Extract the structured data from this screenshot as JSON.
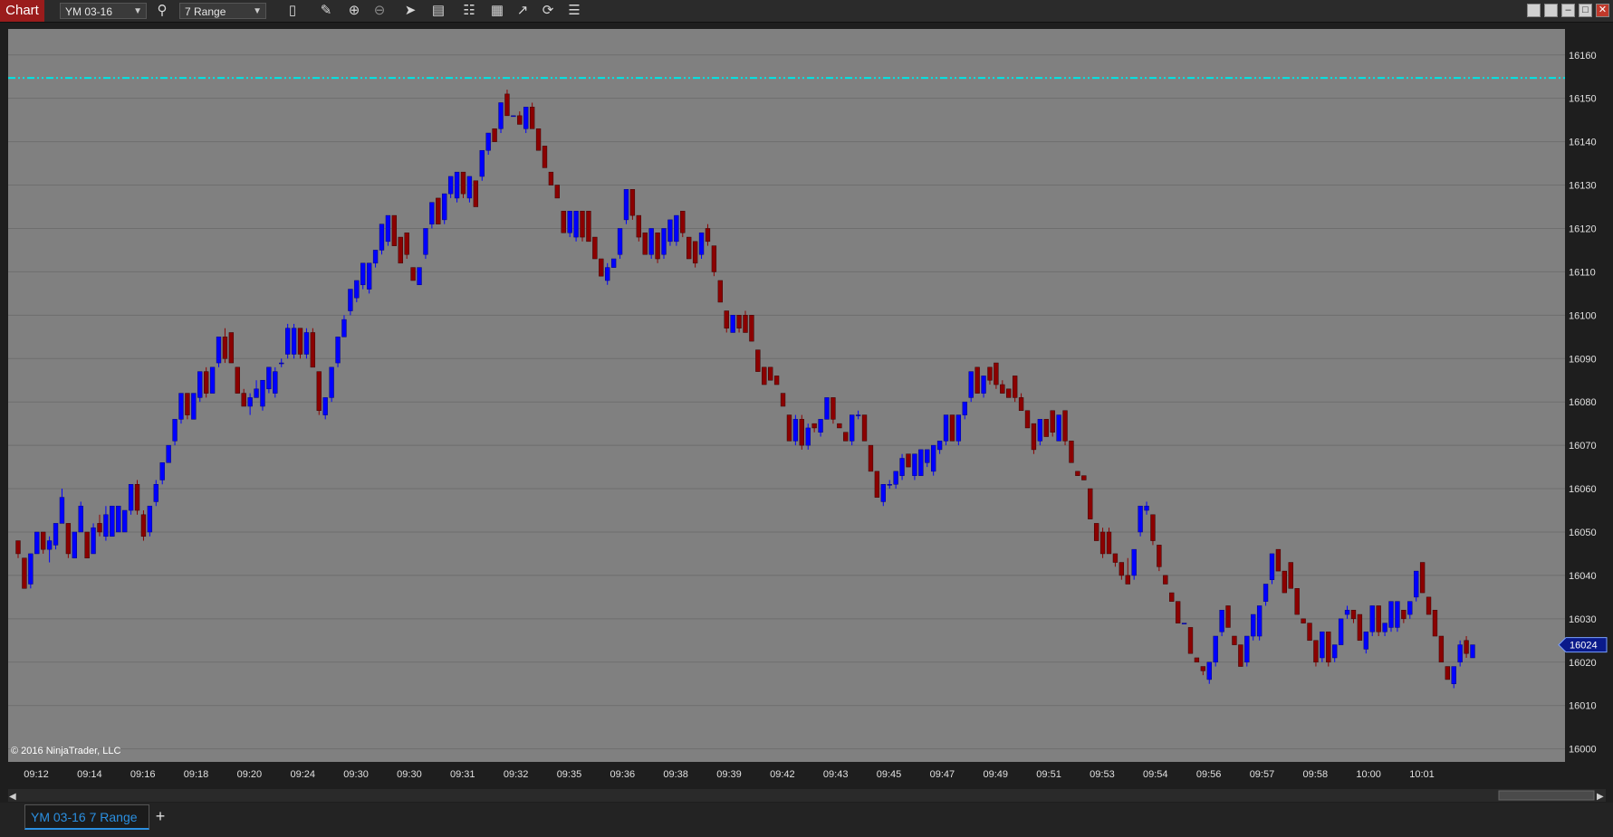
{
  "toolbar": {
    "badge": "Chart",
    "instrument": "YM 03-16",
    "bar_type": "7 Range",
    "icons": [
      "search-icon",
      "bars-style-icon",
      "pencil-icon",
      "zoom-in-icon",
      "zoom-out-icon",
      "pointer-icon",
      "data-box-icon",
      "indicators-icon",
      "strategies-icon",
      "drawing-tools-icon",
      "reload-icon",
      "properties-icon"
    ],
    "window_buttons": [
      "tile-icon",
      "restore-icon",
      "minimize-icon",
      "maximize-icon",
      "close-icon"
    ]
  },
  "colors": {
    "plot_bg": "#808080",
    "up_bar": "#0000ff",
    "down_bar": "#8b0000",
    "level_line": "#00e5e5",
    "last_price_badge": "#0a1a8a",
    "accent": "#2b8fe0",
    "badge_bg": "#9a1c1c"
  },
  "tabs": {
    "active": "YM 03-16 7 Range",
    "add": "+"
  },
  "chart_data": {
    "type": "candlestick",
    "instrument": "YM 03-16",
    "bar_type": "7 Range",
    "copyright": "© 2016 NinjaTrader, LLC",
    "y_ticks": [
      16160,
      16150,
      16140,
      16130,
      16120,
      16110,
      16100,
      16090,
      16080,
      16070,
      16060,
      16050,
      16040,
      16030,
      16020,
      16010,
      16000
    ],
    "ylim": [
      15997,
      16166
    ],
    "x_ticks": [
      "09:12",
      "09:14",
      "09:16",
      "09:18",
      "09:20",
      "09:24",
      "09:30",
      "09:30",
      "09:31",
      "09:32",
      "09:35",
      "09:36",
      "09:38",
      "09:39",
      "09:42",
      "09:43",
      "09:45",
      "09:47",
      "09:49",
      "09:51",
      "09:53",
      "09:54",
      "09:56",
      "09:57",
      "09:58",
      "10:00",
      "10:01"
    ],
    "level_line": 16154.7,
    "last_price": 16024,
    "grid": true,
    "candles": [
      [
        16048,
        16045,
        16048,
        16044
      ],
      [
        16044,
        16037,
        16044,
        16037
      ],
      [
        16038,
        16045,
        16045,
        16037
      ],
      [
        16045,
        16050,
        16050,
        16045
      ],
      [
        16050,
        16046,
        16050,
        16045
      ],
      [
        16046,
        16048,
        16049,
        16043
      ],
      [
        16047,
        16052,
        16052,
        16046
      ],
      [
        16052,
        16058,
        16060,
        16052
      ],
      [
        16052,
        16045,
        16052,
        16044
      ],
      [
        16044,
        16050,
        16050,
        16044
      ],
      [
        16050,
        16056,
        16057,
        16050
      ],
      [
        16050,
        16044,
        16050,
        16044
      ],
      [
        16045,
        16051,
        16052,
        16045
      ],
      [
        16052,
        16050,
        16054,
        16049
      ],
      [
        16049,
        16054,
        16056,
        16048
      ],
      [
        16049,
        16056,
        16056,
        16049
      ],
      [
        16050,
        16056,
        16056,
        16050
      ],
      [
        16050,
        16055,
        16055,
        16050
      ],
      [
        16055,
        16061,
        16061,
        16054
      ],
      [
        16061,
        16055,
        16062,
        16054
      ],
      [
        16054,
        16049,
        16055,
        16048
      ],
      [
        16050,
        16056,
        16056,
        16049
      ],
      [
        16057,
        16061,
        16062,
        16056
      ],
      [
        16062,
        16066,
        16066,
        16061
      ],
      [
        16066,
        16070,
        16070,
        16066
      ],
      [
        16071,
        16076,
        16076,
        16070
      ],
      [
        16076,
        16082,
        16082,
        16075
      ],
      [
        16082,
        16077,
        16082,
        16076
      ],
      [
        16076,
        16082,
        16082,
        16076
      ],
      [
        16081,
        16087,
        16087,
        16080
      ],
      [
        16087,
        16082,
        16088,
        16081
      ],
      [
        16082,
        16088,
        16088,
        16082
      ],
      [
        16089,
        16095,
        16095,
        16088
      ],
      [
        16095,
        16090,
        16097,
        16089
      ],
      [
        16096,
        16089,
        16096,
        16089
      ],
      [
        16088,
        16082,
        16088,
        16082
      ],
      [
        16082,
        16079,
        16083,
        16079
      ],
      [
        16079,
        16081,
        16082,
        16077
      ],
      [
        16081,
        16083,
        16085,
        16081
      ],
      [
        16079,
        16085,
        16085,
        16078
      ],
      [
        16083,
        16088,
        16088,
        16082
      ],
      [
        16082,
        16087,
        16088,
        16081
      ],
      [
        16089,
        16089,
        16090,
        16088
      ],
      [
        16091,
        16097,
        16098,
        16090
      ],
      [
        16091,
        16097,
        16098,
        16090
      ],
      [
        16097,
        16091,
        16097,
        16090
      ],
      [
        16091,
        16096,
        16097,
        16090
      ],
      [
        16096,
        16088,
        16097,
        16088
      ],
      [
        16087,
        16078,
        16087,
        16077
      ],
      [
        16077,
        16081,
        16081,
        16076
      ],
      [
        16081,
        16088,
        16088,
        16080
      ],
      [
        16089,
        16095,
        16095,
        16088
      ],
      [
        16095,
        16099,
        16100,
        16095
      ],
      [
        16101,
        16106,
        16106,
        16100
      ],
      [
        16104,
        16108,
        16108,
        16103
      ],
      [
        16107,
        16112,
        16112,
        16106
      ],
      [
        16106,
        16112,
        16112,
        16105
      ],
      [
        16112,
        16115,
        16115,
        16111
      ],
      [
        16115,
        16121,
        16121,
        16114
      ],
      [
        16117,
        16123,
        16123,
        16116
      ],
      [
        16123,
        16116,
        16123,
        16116
      ],
      [
        16118,
        16112,
        16118,
        16112
      ],
      [
        16119,
        16114,
        16119,
        16113
      ],
      [
        16111,
        16108,
        16111,
        16108
      ],
      [
        16107,
        16111,
        16111,
        16107
      ],
      [
        16114,
        16120,
        16120,
        16113
      ],
      [
        16121,
        16126,
        16126,
        16120
      ],
      [
        16127,
        16121,
        16127,
        16121
      ],
      [
        16122,
        16128,
        16128,
        16121
      ],
      [
        16128,
        16132,
        16132,
        16127
      ],
      [
        16127,
        16133,
        16133,
        16126
      ],
      [
        16133,
        16128,
        16133,
        16127
      ],
      [
        16127,
        16132,
        16132,
        16126
      ],
      [
        16131,
        16125,
        16131,
        16125
      ],
      [
        16132,
        16138,
        16138,
        16131
      ],
      [
        16138,
        16142,
        16142,
        16137
      ],
      [
        16143,
        16140,
        16143,
        16140
      ],
      [
        16143,
        16149,
        16149,
        16142
      ],
      [
        16151,
        16146,
        16152,
        16146
      ],
      [
        16146,
        16146,
        16146,
        16146
      ],
      [
        16146,
        16144,
        16147,
        16144
      ],
      [
        16143,
        16148,
        16148,
        16142
      ],
      [
        16148,
        16143,
        16149,
        16143
      ],
      [
        16143,
        16138,
        16143,
        16138
      ],
      [
        16139,
        16134,
        16139,
        16134
      ],
      [
        16133,
        16130,
        16133,
        16130
      ],
      [
        16130,
        16127,
        16130,
        16127
      ],
      [
        16124,
        16119,
        16124,
        16119
      ],
      [
        16119,
        16124,
        16124,
        16118
      ],
      [
        16118,
        16124,
        16124,
        16117
      ],
      [
        16124,
        16118,
        16124,
        16117
      ],
      [
        16124,
        16117,
        16124,
        16117
      ],
      [
        16118,
        16113,
        16118,
        16113
      ],
      [
        16113,
        16109,
        16113,
        16109
      ],
      [
        16108,
        16111,
        16112,
        16107
      ],
      [
        16111,
        16113,
        16113,
        16111
      ],
      [
        16114,
        16120,
        16120,
        16113
      ],
      [
        16122,
        16129,
        16129,
        16121
      ],
      [
        16129,
        16123,
        16129,
        16122
      ],
      [
        16123,
        16118,
        16123,
        16117
      ],
      [
        16119,
        16114,
        16119,
        16114
      ],
      [
        16114,
        16120,
        16120,
        16113
      ],
      [
        16119,
        16113,
        16119,
        16112
      ],
      [
        16114,
        16120,
        16120,
        16113
      ],
      [
        16117,
        16122,
        16122,
        16116
      ],
      [
        16117,
        16123,
        16123,
        16116
      ],
      [
        16124,
        16119,
        16124,
        16118
      ],
      [
        16118,
        16113,
        16118,
        16113
      ],
      [
        16117,
        16112,
        16117,
        16111
      ],
      [
        16114,
        16119,
        16119,
        16113
      ],
      [
        16120,
        16117,
        16121,
        16116
      ],
      [
        16116,
        16110,
        16116,
        16109
      ],
      [
        16108,
        16103,
        16108,
        16103
      ],
      [
        16101,
        16097,
        16101,
        16096
      ],
      [
        16096,
        16100,
        16100,
        16096
      ],
      [
        16100,
        16097,
        16100,
        16096
      ],
      [
        16100,
        16096,
        16101,
        16096
      ],
      [
        16100,
        16094,
        16100,
        16094
      ],
      [
        16092,
        16087,
        16092,
        16087
      ],
      [
        16088,
        16084,
        16088,
        16084
      ],
      [
        16088,
        16085,
        16088,
        16085
      ],
      [
        16086,
        16084,
        16086,
        16084
      ],
      [
        16082,
        16079,
        16082,
        16079
      ],
      [
        16077,
        16071,
        16077,
        16071
      ],
      [
        16071,
        16076,
        16077,
        16070
      ],
      [
        16076,
        16070,
        16077,
        16069
      ],
      [
        16070,
        16074,
        16075,
        16069
      ],
      [
        16075,
        16074,
        16075,
        16073
      ],
      [
        16073,
        16076,
        16076,
        16072
      ],
      [
        16076,
        16081,
        16081,
        16076
      ],
      [
        16081,
        16076,
        16081,
        16075
      ],
      [
        16075,
        16074,
        16075,
        16074
      ],
      [
        16073,
        16071,
        16073,
        16071
      ],
      [
        16071,
        16077,
        16077,
        16070
      ],
      [
        16077,
        16077,
        16078,
        16076
      ],
      [
        16077,
        16071,
        16077,
        16071
      ],
      [
        16070,
        16064,
        16070,
        16064
      ],
      [
        16064,
        16058,
        16064,
        16058
      ],
      [
        16057,
        16061,
        16061,
        16056
      ],
      [
        16061,
        16061,
        16062,
        16060
      ],
      [
        16061,
        16064,
        16064,
        16060
      ],
      [
        16063,
        16067,
        16068,
        16062
      ],
      [
        16068,
        16065,
        16068,
        16065
      ],
      [
        16063,
        16068,
        16068,
        16062
      ],
      [
        16063,
        16069,
        16069,
        16063
      ],
      [
        16066,
        16069,
        16069,
        16065
      ],
      [
        16064,
        16070,
        16070,
        16063
      ],
      [
        16069,
        16071,
        16071,
        16068
      ],
      [
        16071,
        16077,
        16077,
        16070
      ],
      [
        16077,
        16071,
        16077,
        16071
      ],
      [
        16071,
        16077,
        16077,
        16070
      ],
      [
        16077,
        16080,
        16080,
        16076
      ],
      [
        16081,
        16087,
        16087,
        16080
      ],
      [
        16088,
        16082,
        16088,
        16082
      ],
      [
        16082,
        16086,
        16086,
        16081
      ],
      [
        16088,
        16085,
        16088,
        16084
      ],
      [
        16089,
        16084,
        16089,
        16083
      ],
      [
        16084,
        16082,
        16085,
        16082
      ],
      [
        16083,
        16081,
        16083,
        16081
      ],
      [
        16086,
        16081,
        16086,
        16080
      ],
      [
        16081,
        16078,
        16082,
        16078
      ],
      [
        16078,
        16074,
        16078,
        16074
      ],
      [
        16075,
        16069,
        16075,
        16068
      ],
      [
        16071,
        16076,
        16076,
        16070
      ],
      [
        16076,
        16072,
        16076,
        16072
      ],
      [
        16078,
        16073,
        16078,
        16072
      ],
      [
        16071,
        16077,
        16077,
        16071
      ],
      [
        16078,
        16071,
        16078,
        16070
      ],
      [
        16071,
        16066,
        16071,
        16066
      ],
      [
        16064,
        16063,
        16064,
        16063
      ],
      [
        16063,
        16062,
        16063,
        16062
      ],
      [
        16060,
        16053,
        16060,
        16053
      ],
      [
        16052,
        16048,
        16052,
        16048
      ],
      [
        16050,
        16045,
        16051,
        16044
      ],
      [
        16050,
        16045,
        16051,
        16045
      ],
      [
        16045,
        16043,
        16045,
        16042
      ],
      [
        16043,
        16040,
        16043,
        16039
      ],
      [
        16040,
        16038,
        16044,
        16038
      ],
      [
        16040,
        16046,
        16046,
        16039
      ],
      [
        16050,
        16056,
        16056,
        16049
      ],
      [
        16055,
        16056,
        16057,
        16054
      ],
      [
        16054,
        16048,
        16054,
        16047
      ],
      [
        16047,
        16042,
        16047,
        16041
      ],
      [
        16040,
        16038,
        16040,
        16038
      ],
      [
        16036,
        16034,
        16036,
        16034
      ],
      [
        16034,
        16029,
        16034,
        16029
      ],
      [
        16029,
        16029,
        16029,
        16029
      ],
      [
        16028,
        16022,
        16028,
        16022
      ],
      [
        16021,
        16020,
        16021,
        16020
      ],
      [
        16019,
        16018,
        16019,
        16017
      ],
      [
        16016,
        16020,
        16020,
        16015
      ],
      [
        16020,
        16026,
        16026,
        16019
      ],
      [
        16027,
        16032,
        16032,
        16026
      ],
      [
        16033,
        16028,
        16033,
        16028
      ],
      [
        16026,
        16024,
        16026,
        16024
      ],
      [
        16024,
        16019,
        16024,
        16019
      ],
      [
        16020,
        16026,
        16026,
        16019
      ],
      [
        16026,
        16031,
        16031,
        16025
      ],
      [
        16026,
        16033,
        16033,
        16025
      ],
      [
        16034,
        16038,
        16038,
        16033
      ],
      [
        16039,
        16045,
        16045,
        16038
      ],
      [
        16046,
        16041,
        16046,
        16041
      ],
      [
        16041,
        16036,
        16041,
        16036
      ],
      [
        16043,
        16037,
        16043,
        16037
      ],
      [
        16037,
        16031,
        16037,
        16031
      ],
      [
        16030,
        16029,
        16030,
        16029
      ],
      [
        16029,
        16025,
        16029,
        16025
      ],
      [
        16025,
        16020,
        16025,
        16019
      ],
      [
        16021,
        16027,
        16027,
        16020
      ],
      [
        16027,
        16020,
        16027,
        16019
      ],
      [
        16021,
        16024,
        16024,
        16020
      ],
      [
        16024,
        16030,
        16030,
        16024
      ],
      [
        16031,
        16032,
        16033,
        16030
      ],
      [
        16032,
        16030,
        16032,
        16029
      ],
      [
        16031,
        16025,
        16031,
        16025
      ],
      [
        16023,
        16027,
        16027,
        16022
      ],
      [
        16027,
        16033,
        16033,
        16026
      ],
      [
        16033,
        16027,
        16033,
        16026
      ],
      [
        16027,
        16029,
        16029,
        16026
      ],
      [
        16028,
        16034,
        16034,
        16027
      ],
      [
        16028,
        16034,
        16034,
        16027
      ],
      [
        16032,
        16030,
        16032,
        16029
      ],
      [
        16031,
        16034,
        16034,
        16030
      ],
      [
        16035,
        16041,
        16041,
        16034
      ],
      [
        16043,
        16036,
        16043,
        16036
      ],
      [
        16035,
        16031,
        16035,
        16031
      ],
      [
        16032,
        16026,
        16032,
        16026
      ],
      [
        16026,
        16020,
        16026,
        16020
      ],
      [
        16019,
        16016,
        16019,
        16016
      ],
      [
        16015,
        16019,
        16019,
        16014
      ],
      [
        16020,
        16024,
        16025,
        16019
      ],
      [
        16025,
        16022,
        16026,
        16021
      ],
      [
        16021,
        16024,
        16024,
        16021
      ]
    ]
  }
}
